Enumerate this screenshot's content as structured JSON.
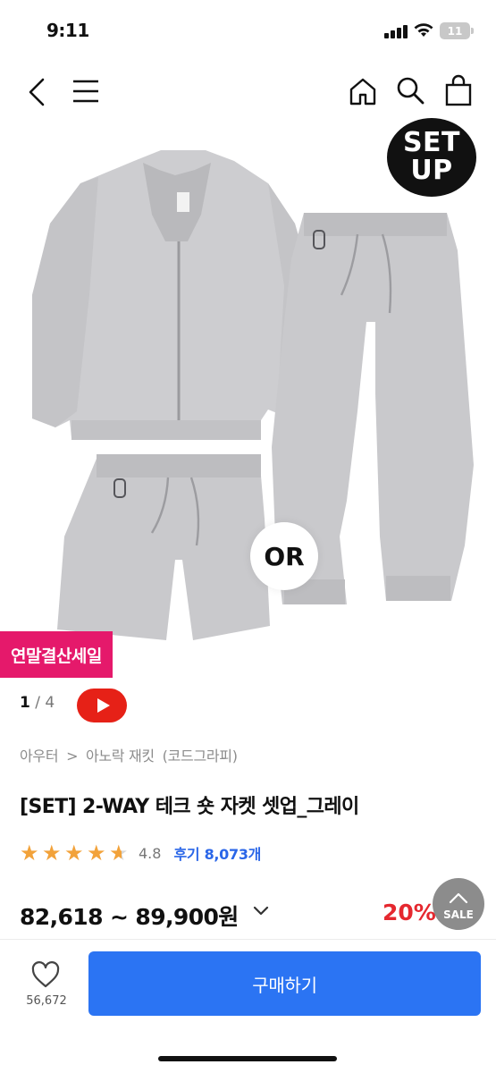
{
  "status_bar": {
    "time": "9:11",
    "battery": "11"
  },
  "header": {
    "icons": [
      "back-chevron-icon",
      "menu-icon",
      "home-icon",
      "search-icon",
      "shopping-bag-icon"
    ]
  },
  "product": {
    "badge_line1": "SET",
    "badge_line2": "UP",
    "or_label": "OR",
    "sale_tag": "연말결산세일",
    "image_index": "1",
    "image_total": "4",
    "breadcrumb": [
      "아우터",
      ">",
      "아노락 재킷",
      "(코드그라피)"
    ],
    "title": "[SET] 2-WAY 테크 숏 자켓 셋업_그레이",
    "rating": "4.8",
    "rating_stars": 4.5,
    "review_label": "후기 8,073개",
    "price": "82,618 ~ 89,900원",
    "discount": "20%",
    "sale_fab_label": "SALE"
  },
  "bottom_bar": {
    "like_count": "56,672",
    "buy_label": "구매하기"
  },
  "colors": {
    "accent_blue": "#2b74f3",
    "sale_pink": "#e5196b",
    "discount_red": "#e5282f",
    "star_orange": "#f2a23a"
  }
}
